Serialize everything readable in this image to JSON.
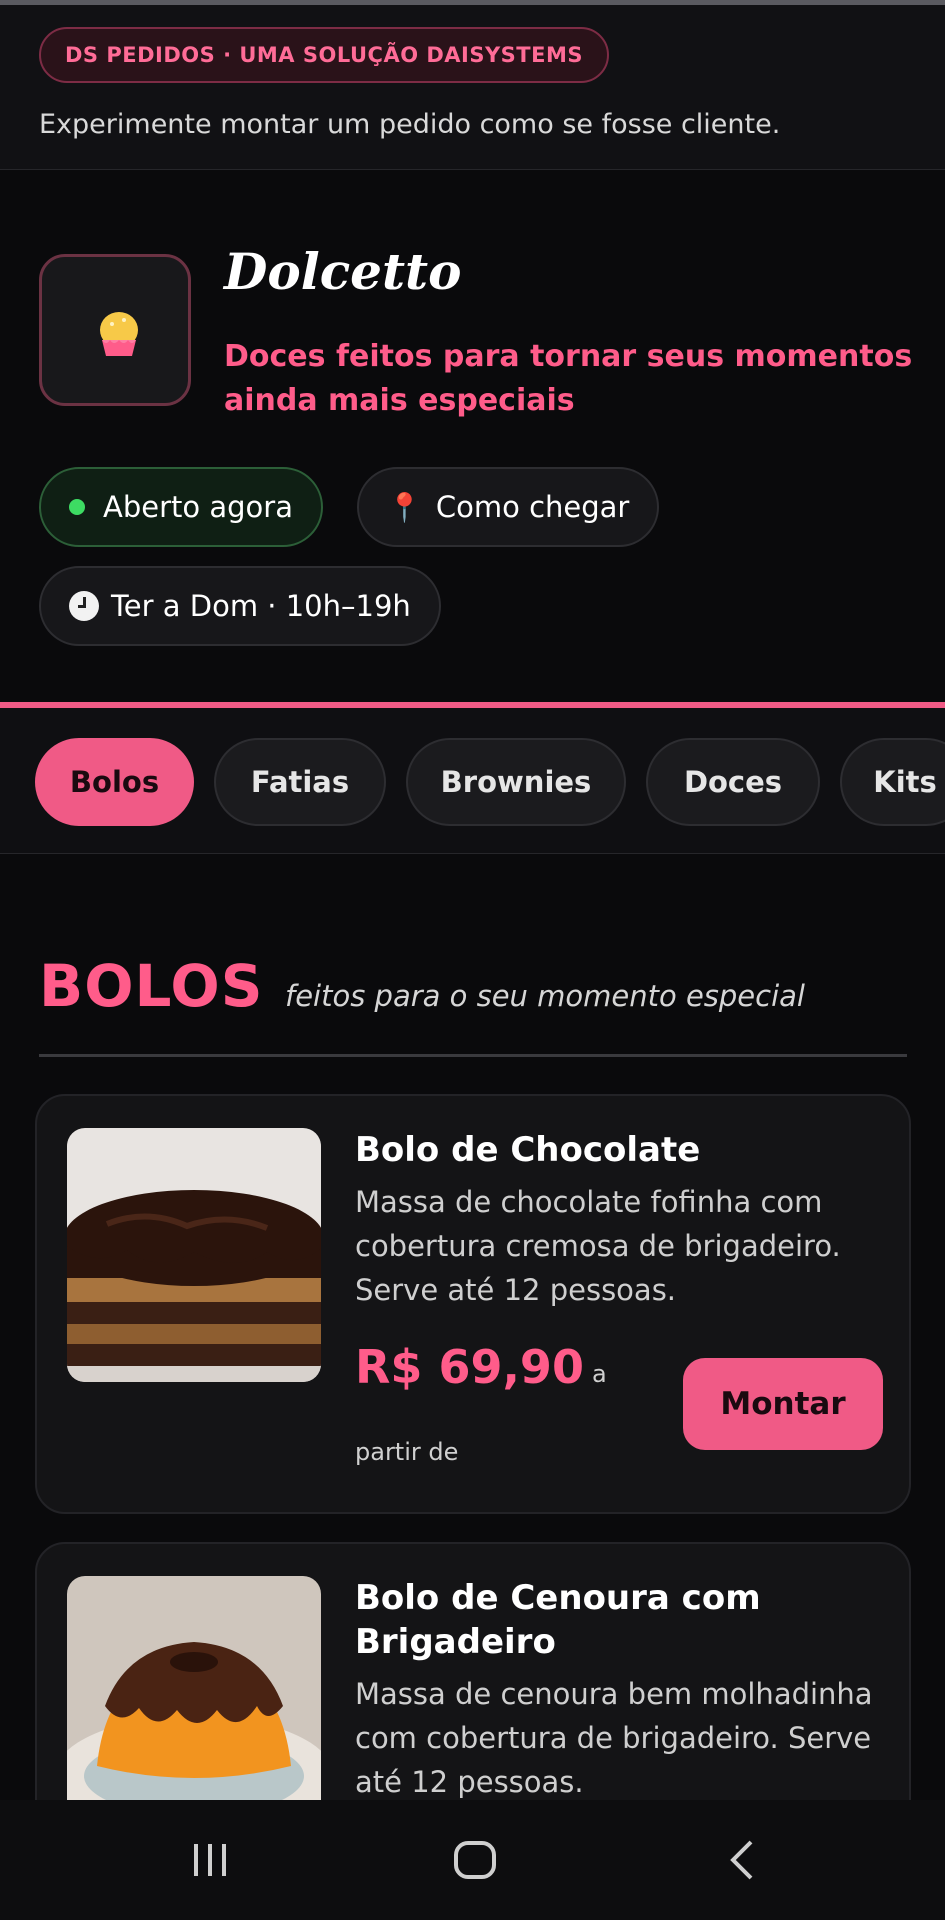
{
  "promo": {
    "badge": "DS PEDIDOS · UMA SOLUÇÃO DAISYSTEMS",
    "text": "Experimente montar um pedido como se fosse cliente."
  },
  "store": {
    "logo_icon": "muffin-icon",
    "name": "Dolcetto",
    "tagline": "Doces feitos para tornar seus momentos ainda mais especiais",
    "status": "Aberto agora",
    "directions": "Como chegar",
    "hours": "Ter a Dom · 10h–19h"
  },
  "tabs": [
    "Bolos",
    "Fatias",
    "Brownies",
    "Doces",
    "Kits"
  ],
  "active_tab": "Bolos",
  "section": {
    "title": "BOLOS",
    "subtitle": "feitos para o seu momento especial"
  },
  "products": [
    {
      "title": "Bolo de Chocolate",
      "description": "Massa de chocolate fofinha com cobertura cremosa de brigadeiro. Serve até 12 pessoas.",
      "price": "R$ 69,90",
      "price_suffix_a": "a",
      "price_suffix_b": "partir de",
      "button": "Montar"
    },
    {
      "title": "Bolo de Cenoura com Brigadeiro",
      "description": "Massa de cenoura bem molhadinha com cobertura de brigadeiro. Serve até 12 pessoas."
    }
  ],
  "colors": {
    "accent": "#f05a86",
    "background": "#0a0a0c",
    "open_green": "#3ddc63"
  },
  "nav": {
    "recents_icon": "recents-icon",
    "home_icon": "home-icon",
    "back_icon": "back-icon"
  }
}
